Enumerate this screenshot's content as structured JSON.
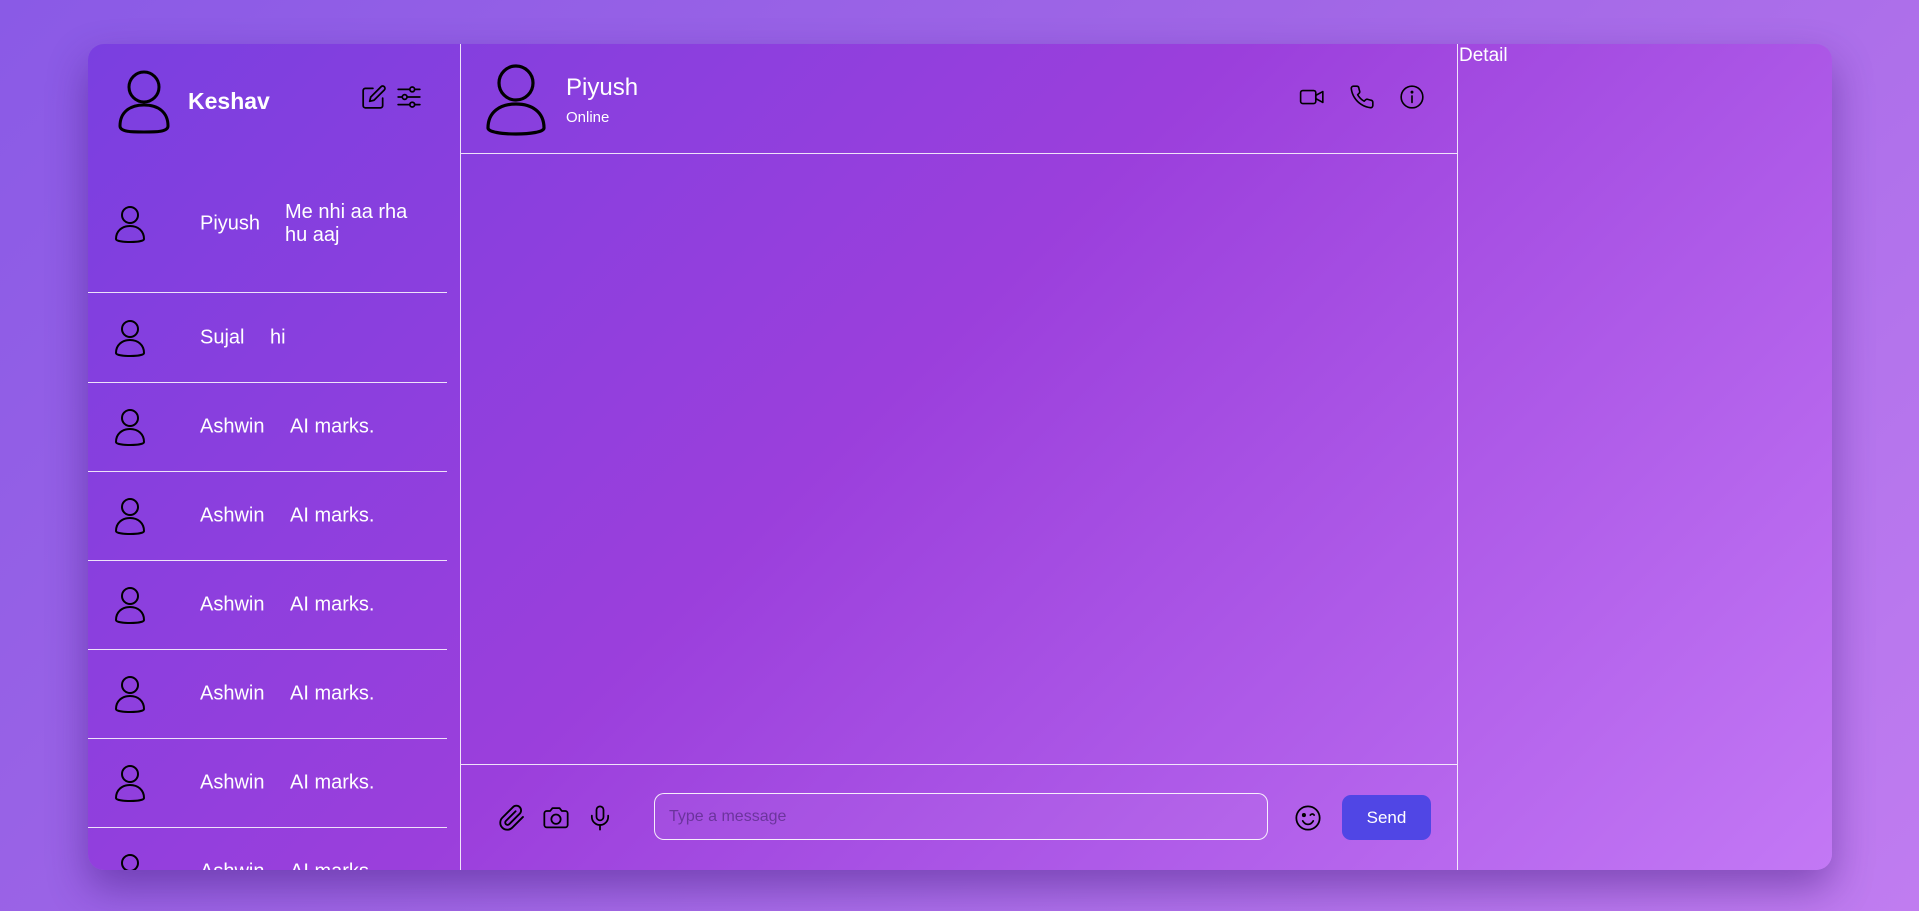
{
  "user": {
    "name": "Keshav",
    "icons": [
      "edit-icon",
      "filter-icon"
    ]
  },
  "chats": [
    {
      "name": "Piyush",
      "message": "Me nhi aa rha hu aaj"
    },
    {
      "name": "Sujal",
      "message": "hi"
    },
    {
      "name": "Ashwin",
      "message": "AI marks."
    },
    {
      "name": "Ashwin",
      "message": "AI marks."
    },
    {
      "name": "Ashwin",
      "message": "AI marks."
    },
    {
      "name": "Ashwin",
      "message": "AI marks."
    },
    {
      "name": "Ashwin",
      "message": "AI marks."
    },
    {
      "name": "Ashwin",
      "message": "AI marks."
    }
  ],
  "chat_header": {
    "name": "Piyush",
    "status": "Online",
    "icons": [
      "video-icon",
      "phone-icon",
      "info-icon"
    ]
  },
  "composer": {
    "placeholder": "Type a message",
    "send_label": "Send",
    "icons": [
      "attachment-icon",
      "camera-icon",
      "microphone-icon",
      "emoji-icon"
    ]
  },
  "detail": {
    "title": "Detail"
  },
  "colors": {
    "accent": "#5046e5",
    "panel_gradient_start": "#7a3fe0",
    "panel_gradient_end": "#c378f5"
  }
}
